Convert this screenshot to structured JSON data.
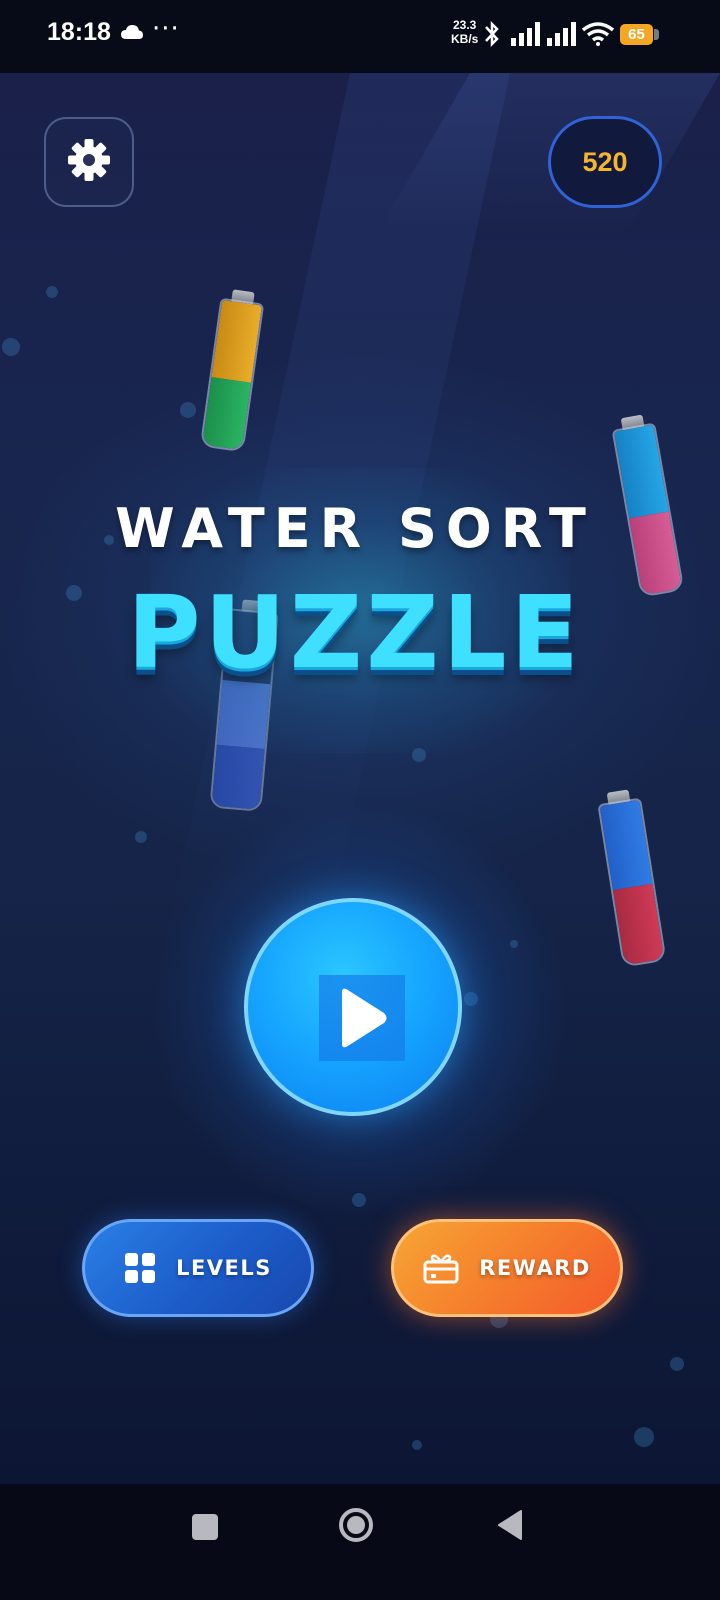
{
  "status_bar": {
    "time": "18:18",
    "cloud_icon": "cloud-icon",
    "more_dots": "···",
    "net_speed_value": "23.3",
    "net_speed_unit": "KB/s",
    "battery_level": "65",
    "icons": [
      "bluetooth-icon",
      "signal-icon",
      "signal-icon",
      "wifi-icon",
      "battery-icon"
    ]
  },
  "header": {
    "settings_icon": "gear-icon",
    "coins": "520"
  },
  "title": {
    "line1": "WATER SORT",
    "line2": "PUZZLE"
  },
  "play": {
    "icon": "play-icon"
  },
  "buttons": {
    "levels_label": "LEVELS",
    "levels_icon": "grid-icon",
    "reward_label": "REWARD",
    "reward_icon": "gift-icon"
  },
  "bottles": [
    {
      "name": "bottle-top-left",
      "layers": [
        "#e0a21e",
        "#23a55a"
      ]
    },
    {
      "name": "bottle-right-upper",
      "layers": [
        "#1d9de0",
        "#d4548e"
      ]
    },
    {
      "name": "bottle-center",
      "layers": [
        "#3a66d4",
        "#2b4fb8"
      ]
    },
    {
      "name": "bottle-right-lower",
      "layers": [
        "#2a6fdc",
        "#c8344e"
      ]
    }
  ],
  "colors": {
    "coin_text": "#f7b52d",
    "title_cyan": "#3fe0ff",
    "play_blue": "#16a6ff",
    "levels_blue": "#1c5cc9",
    "reward_orange": "#f57b2c"
  },
  "nav_bar": {
    "recents_icon": "square-icon",
    "home_icon": "home-circle-icon",
    "back_icon": "back-triangle-icon"
  }
}
